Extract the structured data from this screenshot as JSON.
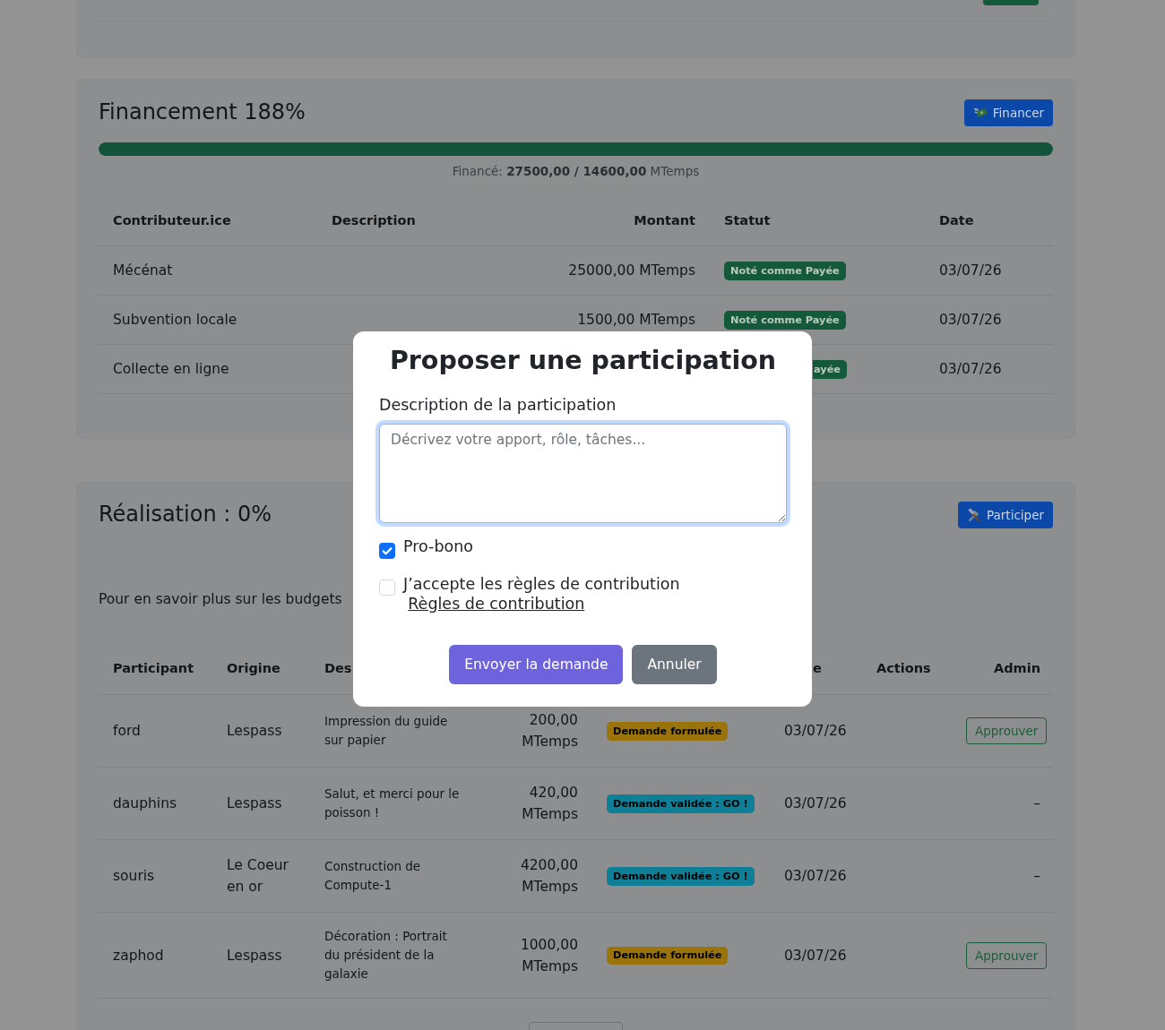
{
  "funding": {
    "title": "Financement 188%",
    "button": {
      "label": "Financer"
    },
    "progress": {
      "level": 1
    },
    "summary": "Financé: **27500,00 / 14600,00** MTemps",
    "table": {
      "columns": [
        "Contributeur.ice",
        "Description",
        "Montant",
        "Statut",
        "Date"
      ],
      "rows": [
        {
          "contributor": "Mécénat",
          "amount": "25000,00 MTemps",
          "status": {
            "text": "Noté comme Payée",
            "kind": "paid",
            "cut_off": false
          },
          "date": "03/07/26"
        },
        {
          "contributor": "Subvention locale",
          "amount": "1500,00 MTemps",
          "status": {
            "text": "Noté comme Payée",
            "kind": "paid",
            "cut_off": false
          },
          "date": "03/07/26"
        },
        {
          "contributor": "Collecte en ligne",
          "status": {
            "text": "ayée",
            "kind": "paid",
            "cut_off": true
          },
          "date": "03/07/26"
        }
      ]
    }
  },
  "realisation": {
    "title": "Réalisation : 0%",
    "button": {
      "label": "Participer"
    },
    "info": "Pour en savoir plus sur les budgets",
    "table": {
      "columns": {
        "participant": "Participant",
        "origin": "Origine",
        "description": "Des",
        "date": "e",
        "actions": "Actions",
        "admin": "Admin"
      },
      "rows": [
        {
          "participant": "ford",
          "origin": "Lespass",
          "description": "Impression du guide sur papier",
          "amount": "200,00 MTemps",
          "status": {
            "text": "Demande formulée",
            "kind": "requested",
            "cut_off": false
          },
          "date": "03/07/26",
          "admin": {
            "kind": "button",
            "label": "Approuver"
          }
        },
        {
          "participant": "dauphins",
          "origin": "Lespass",
          "description": "Salut, et merci pour le poisson !",
          "amount": "420,00 MTemps",
          "status": {
            "text": "Demande validée : GO !",
            "kind": "validated",
            "cut_off": false
          },
          "date": "03/07/26",
          "admin": {
            "kind": "dash",
            "label": "–"
          }
        },
        {
          "participant": "souris",
          "origin": "Le Coeur en or",
          "description": "Construction de Compute-1",
          "amount": "4200,00 MTemps",
          "status": {
            "text": "Demande validée : GO !",
            "kind": "validated",
            "cut_off": false
          },
          "date": "03/07/26",
          "admin": {
            "kind": "dash",
            "label": "–"
          }
        },
        {
          "participant": "zaphod",
          "origin": "Lespass",
          "description": "Décoration : Portrait du président de la galaxie",
          "amount": "1000,00 MTemps",
          "status": {
            "text": "Demande formulée",
            "kind": "requested",
            "cut_off": false
          },
          "date": "03/07/26",
          "admin": {
            "kind": "button",
            "label": "Approuver"
          }
        }
      ]
    }
  },
  "dialog": {
    "title": "Proposer une participation",
    "field_label": "Description de la participation",
    "textarea": {
      "placeholder": "Décrivez votre apport, rôle, tâches...",
      "focused": true
    },
    "checkboxes": [
      {
        "label": "Pro-bono",
        "checked": true
      },
      {
        "label": "J’accepte les règles de contribution",
        "link": "Règles de contribution",
        "checked": false
      }
    ],
    "buttons": [
      {
        "label": "Envoyer la demande",
        "kind": "primary"
      },
      {
        "label": "Annuler",
        "kind": "secondary"
      }
    ]
  }
}
